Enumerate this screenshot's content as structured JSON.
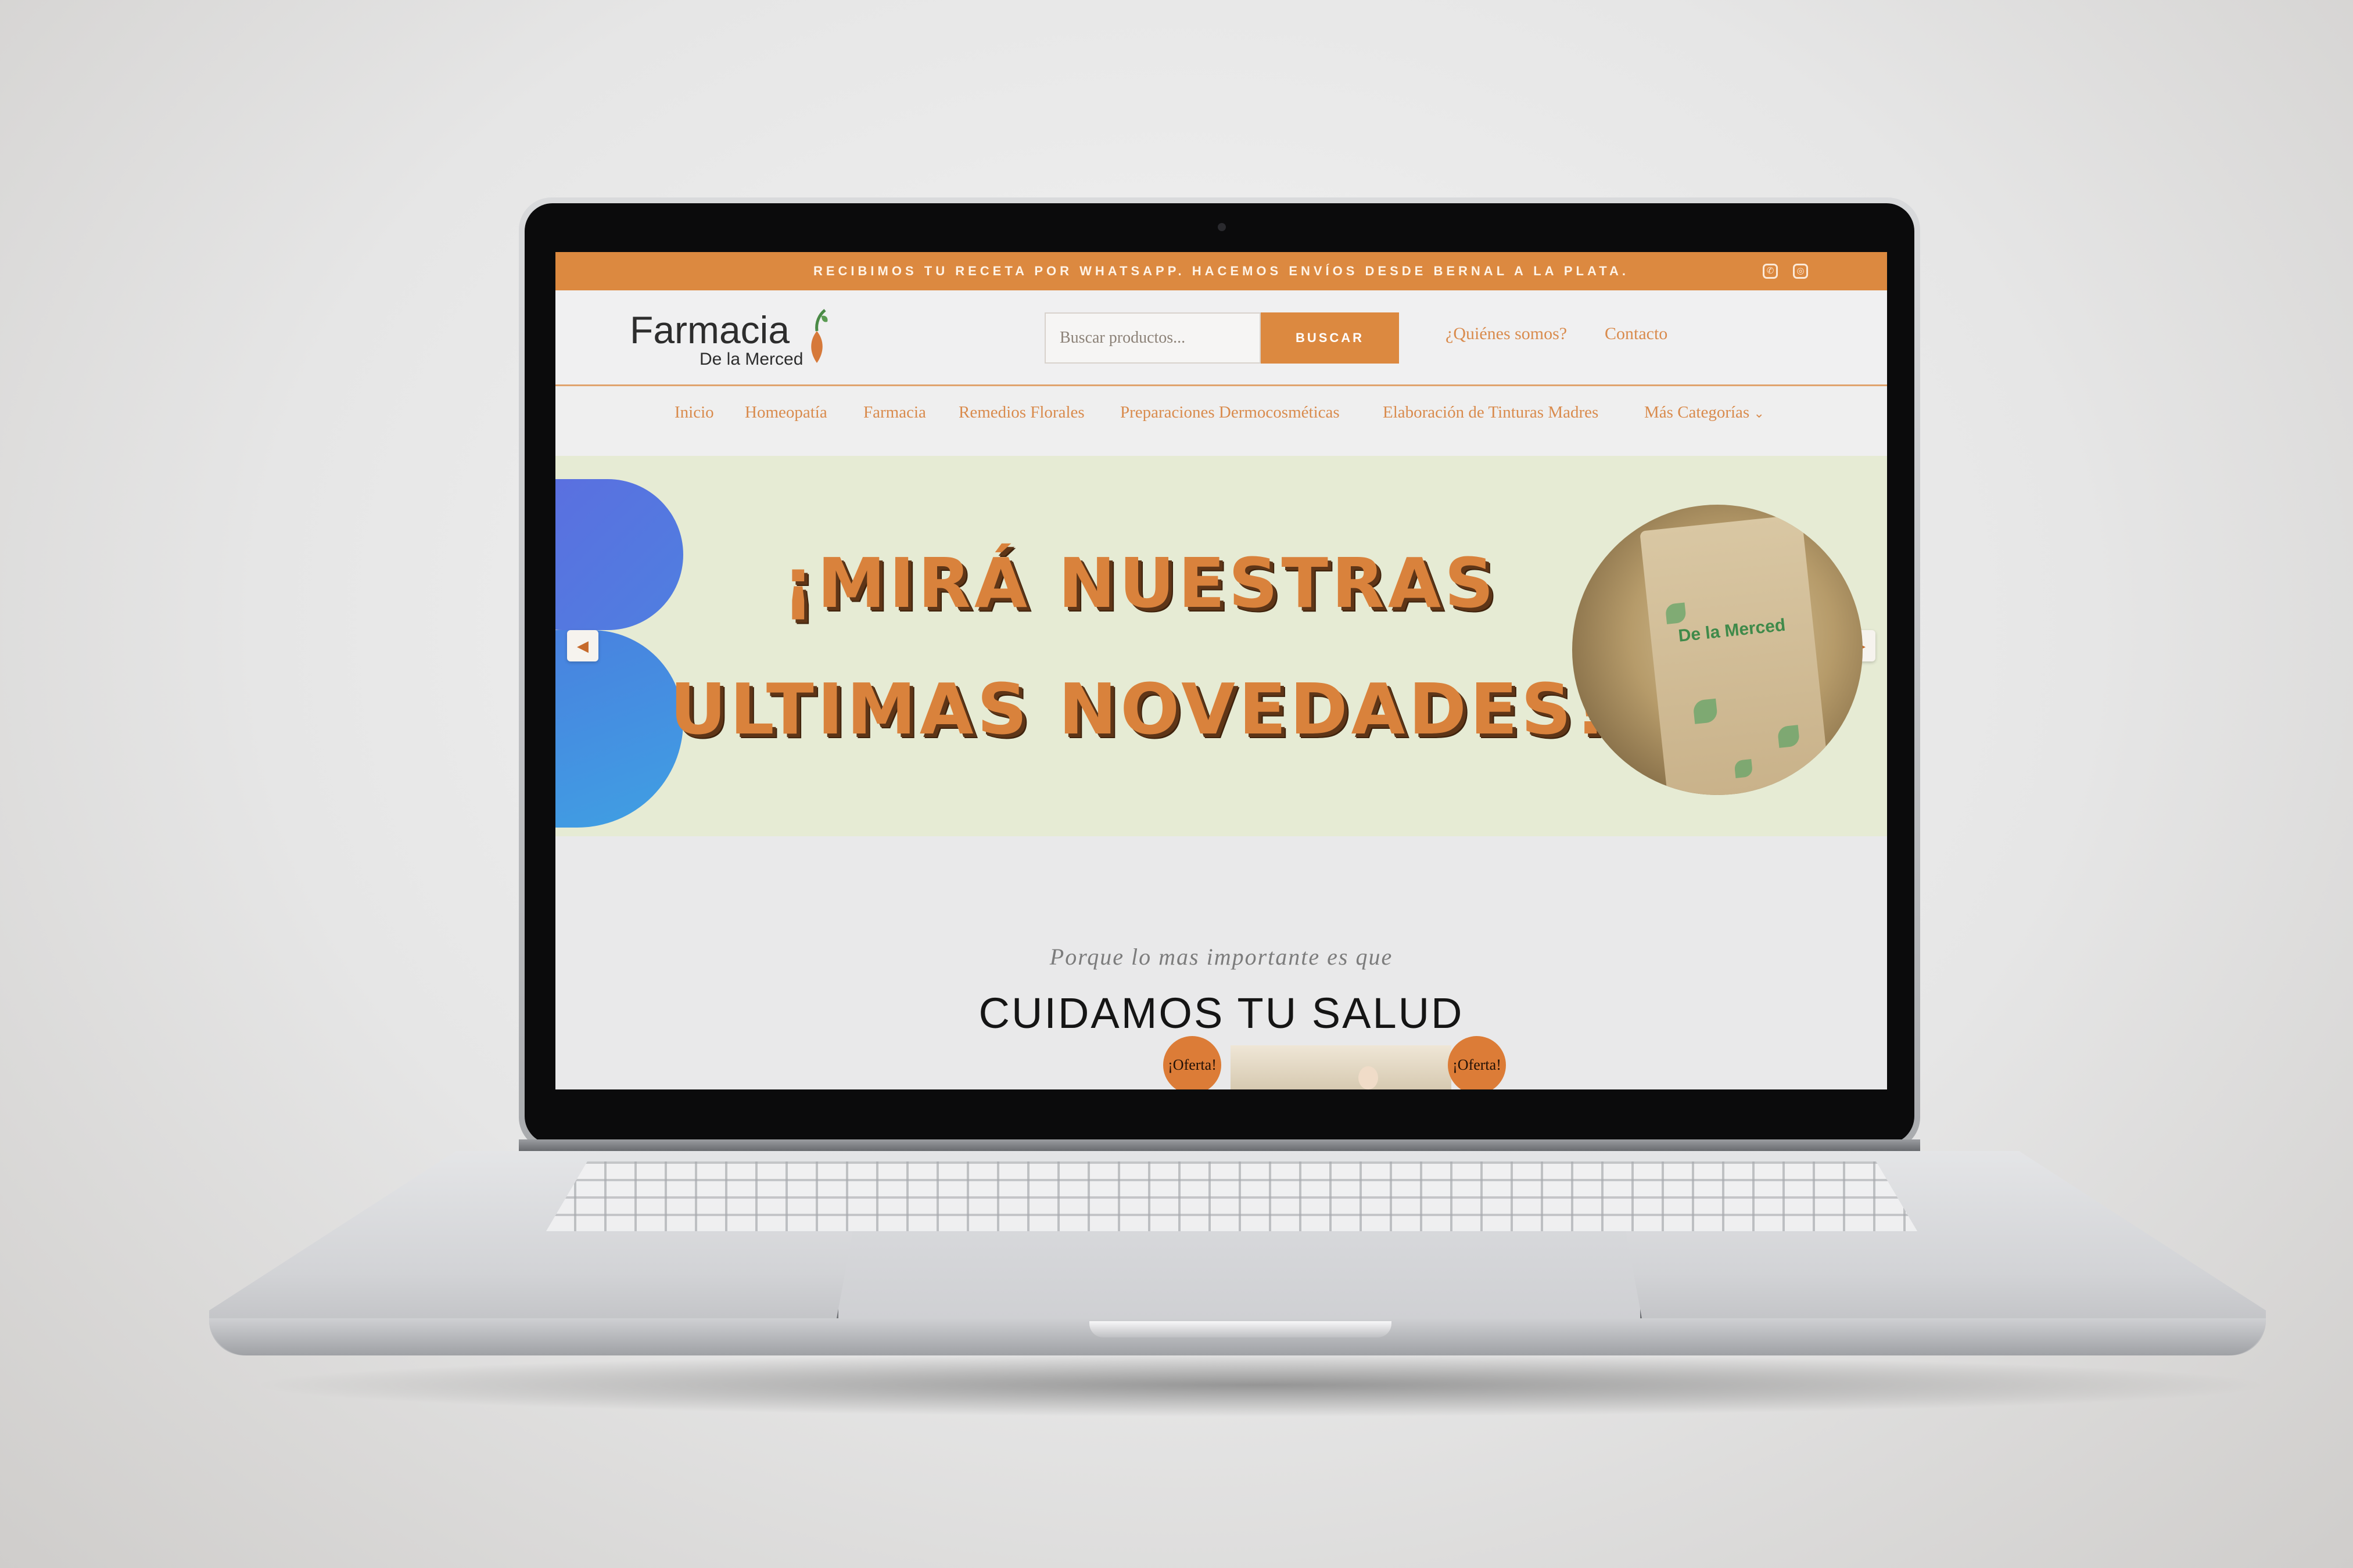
{
  "topbar": {
    "message": "RECIBIMOS TU RECETA POR WHATSAPP. HACEMOS ENVÍOS DESDE BERNAL A LA PLATA.",
    "social_icons": [
      "whatsapp-icon",
      "instagram-icon"
    ]
  },
  "header": {
    "logo_title": "Farmacia",
    "logo_subtitle": "De la Merced",
    "search": {
      "placeholder": "Buscar productos...",
      "button_label": "BUSCAR"
    },
    "links": [
      "¿Quiénes somos?",
      "Contacto"
    ]
  },
  "nav": {
    "items": [
      "Inicio",
      "Homeopatía",
      "Farmacia",
      "Remedios Florales",
      "Preparaciones Dermocosméticas",
      "Elaboración de Tinturas Madres",
      "Más Categorías"
    ]
  },
  "hero": {
    "line1": "¡MIRÁ NUESTRAS",
    "line2": "ULTIMAS NOVEDADES!",
    "product_label": "De la Merced"
  },
  "section": {
    "tagline": "Porque lo mas importante es que",
    "title": "CUIDAMOS TU SALUD",
    "badges": [
      "¡Oferta!",
      "¡Oferta!"
    ]
  },
  "colors": {
    "brand_orange": "#dc8940",
    "link_orange": "#d98b4d",
    "hero_bg": "#e6ebd4",
    "blob_blue": "#4f7fe0"
  }
}
